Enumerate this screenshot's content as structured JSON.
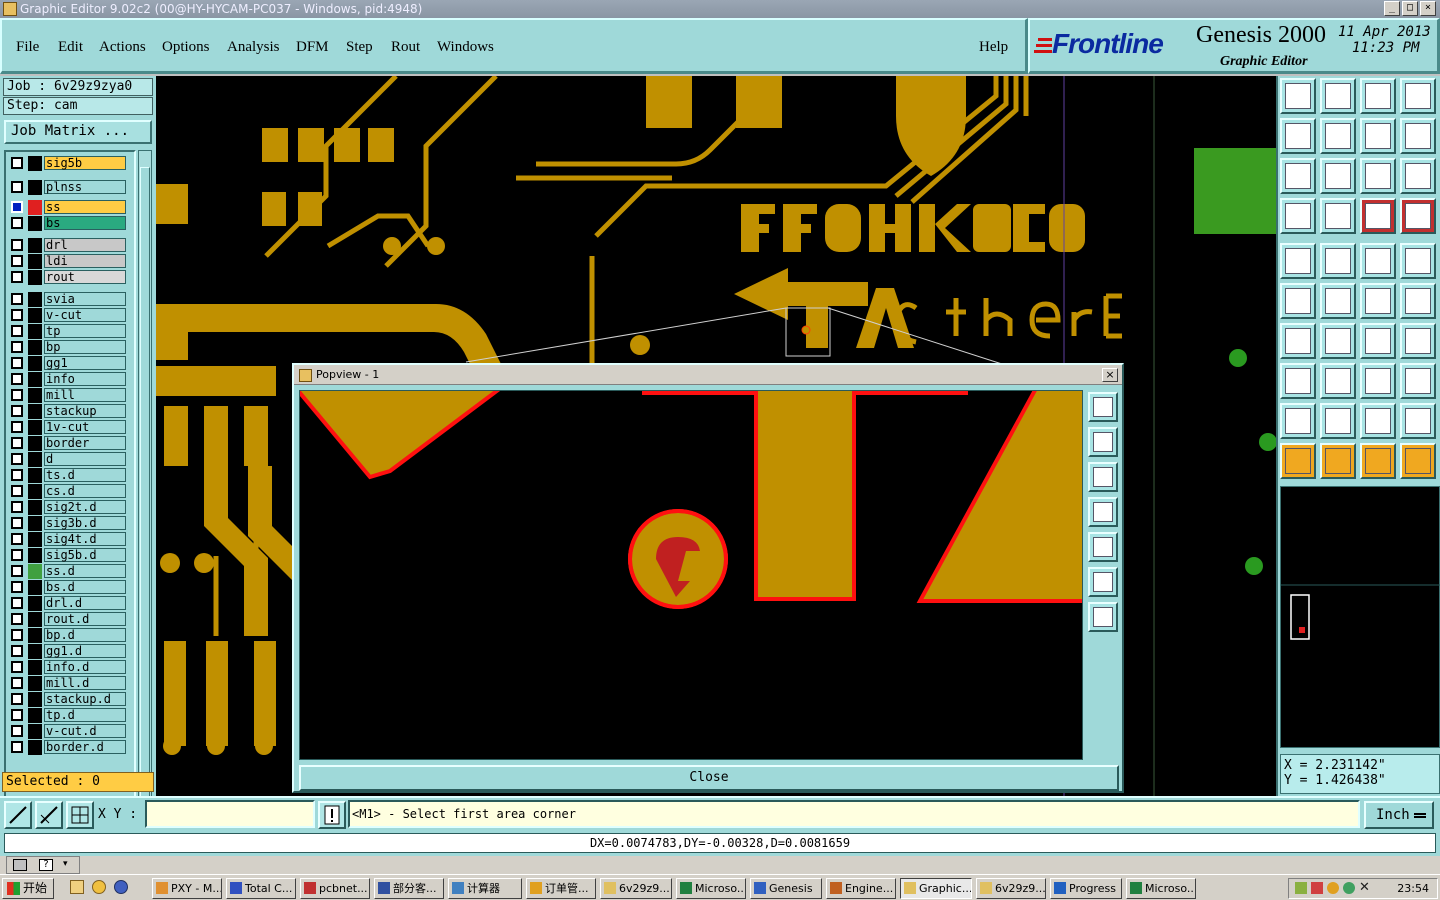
{
  "window": {
    "title": "Graphic Editor 9.02c2 (00@HY-HYCAM-PC037 - Windows, pid:4948)"
  },
  "menu": {
    "items": [
      "File",
      "Edit",
      "Actions",
      "Options",
      "Analysis",
      "DFM",
      "Step",
      "Rout",
      "Windows"
    ],
    "help": "Help"
  },
  "brand": {
    "logo": "Frontline",
    "product": "Genesis 2000",
    "subtitle": "Graphic Editor",
    "date": "11 Apr 2013",
    "time": "11:23 PM"
  },
  "job": {
    "job_line": "Job : 6v29z9zya0",
    "step_line": "Step: cam",
    "matrix_button": "Job Matrix ..."
  },
  "layers": [
    {
      "name": "sig5b",
      "color": "#ffcc44",
      "swatch": "#000000",
      "checked": false
    },
    {
      "name": "plnss",
      "color": "#9fd9d9",
      "swatch": "#000000",
      "checked": false
    },
    {
      "name": "ss",
      "color": "#ffcc44",
      "swatch": "#e02020",
      "checked": true
    },
    {
      "name": "bs",
      "color": "#2aaa80",
      "swatch": "#000000",
      "checked": false
    },
    {
      "name": "drl",
      "color": "#c8c8c8",
      "swatch": "#000000",
      "checked": false
    },
    {
      "name": "ldi",
      "color": "#c8c8c8",
      "swatch": "#000000",
      "checked": false
    },
    {
      "name": "rout",
      "color": "#d8d8d8",
      "swatch": "#000000",
      "checked": false
    },
    {
      "name": "svia",
      "color": "#9fd9d9",
      "swatch": "#000000",
      "checked": false
    },
    {
      "name": "v-cut",
      "color": "#9fd9d9",
      "swatch": "#000000",
      "checked": false
    },
    {
      "name": "tp",
      "color": "#9fd9d9",
      "swatch": "#000000",
      "checked": false
    },
    {
      "name": "bp",
      "color": "#9fd9d9",
      "swatch": "#000000",
      "checked": false
    },
    {
      "name": "gg1",
      "color": "#9fd9d9",
      "swatch": "#000000",
      "checked": false
    },
    {
      "name": "info",
      "color": "#9fd9d9",
      "swatch": "#000000",
      "checked": false
    },
    {
      "name": "mill",
      "color": "#9fd9d9",
      "swatch": "#000000",
      "checked": false
    },
    {
      "name": "stackup",
      "color": "#9fd9d9",
      "swatch": "#000000",
      "checked": false
    },
    {
      "name": "1v-cut",
      "color": "#9fd9d9",
      "swatch": "#000000",
      "checked": false
    },
    {
      "name": "border",
      "color": "#9fd9d9",
      "swatch": "#000000",
      "checked": false
    },
    {
      "name": "d",
      "color": "#9fd9d9",
      "swatch": "#000000",
      "checked": false
    },
    {
      "name": "ts.d",
      "color": "#9fd9d9",
      "swatch": "#000000",
      "checked": false
    },
    {
      "name": "cs.d",
      "color": "#9fd9d9",
      "swatch": "#000000",
      "checked": false
    },
    {
      "name": "sig2t.d",
      "color": "#9fd9d9",
      "swatch": "#000000",
      "checked": false
    },
    {
      "name": "sig3b.d",
      "color": "#9fd9d9",
      "swatch": "#000000",
      "checked": false
    },
    {
      "name": "sig4t.d",
      "color": "#9fd9d9",
      "swatch": "#000000",
      "checked": false
    },
    {
      "name": "sig5b.d",
      "color": "#9fd9d9",
      "swatch": "#000000",
      "checked": false
    },
    {
      "name": "ss.d",
      "color": "#9fd9d9",
      "swatch": "#40a040",
      "checked": false
    },
    {
      "name": "bs.d",
      "color": "#9fd9d9",
      "swatch": "#000000",
      "checked": false
    },
    {
      "name": "drl.d",
      "color": "#9fd9d9",
      "swatch": "#000000",
      "checked": false
    },
    {
      "name": "rout.d",
      "color": "#9fd9d9",
      "swatch": "#000000",
      "checked": false
    },
    {
      "name": "bp.d",
      "color": "#9fd9d9",
      "swatch": "#000000",
      "checked": false
    },
    {
      "name": "gg1.d",
      "color": "#9fd9d9",
      "swatch": "#000000",
      "checked": false
    },
    {
      "name": "info.d",
      "color": "#9fd9d9",
      "swatch": "#000000",
      "checked": false
    },
    {
      "name": "mill.d",
      "color": "#9fd9d9",
      "swatch": "#000000",
      "checked": false
    },
    {
      "name": "stackup.d",
      "color": "#9fd9d9",
      "swatch": "#000000",
      "checked": false
    },
    {
      "name": "tp.d",
      "color": "#9fd9d9",
      "swatch": "#000000",
      "checked": false
    },
    {
      "name": "v-cut.d",
      "color": "#9fd9d9",
      "swatch": "#000000",
      "checked": false
    },
    {
      "name": "border.d",
      "color": "#9fd9d9",
      "swatch": "#000000",
      "checked": false
    }
  ],
  "selected": "Selected : 0",
  "canvas": {
    "board_text_1": "BECKHOFF",
    "board_text_2": "EtherCAT",
    "copper_color": "#c09000",
    "outline_color": "#ff1010"
  },
  "popview": {
    "title": "Popview - 1",
    "close_label": "Close"
  },
  "coords": {
    "x": "X = 2.231142\"",
    "y": "Y = 1.426438\""
  },
  "command": {
    "xy_label": "X Y :",
    "xy_value": "",
    "prompt": "<M1> - Select first area corner",
    "unit": "Inch"
  },
  "status": {
    "message": "DX=0.0074783,DY=-0.00328,D=0.0081659"
  },
  "taskbar": {
    "start": "开始",
    "tasks": [
      "PXY - M...",
      "Total C...",
      "pcbnet...",
      "部分客...",
      "计算器",
      "订单管...",
      "6v29z9...",
      "Microso...",
      "Genesis",
      "Engine...",
      "Graphic...",
      "6v29z9...",
      "Progress",
      "Microso..."
    ],
    "active_index": 10,
    "clock": "23:54"
  }
}
